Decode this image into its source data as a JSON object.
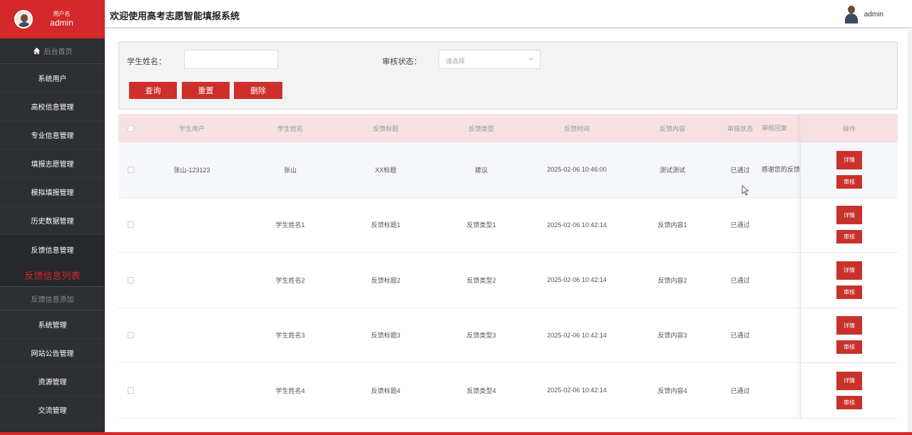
{
  "app": {
    "title": "欢迎使用高考志愿智能填报系统",
    "user_label": "用户名",
    "username": "admin",
    "header_user": "admin"
  },
  "sidebar": {
    "home": "后台首页",
    "items": [
      {
        "label": "系统用户"
      },
      {
        "label": "高校信息管理"
      },
      {
        "label": "专业信息管理"
      },
      {
        "label": "填报志愿管理"
      },
      {
        "label": "模拟填报管理"
      },
      {
        "label": "历史数据管理"
      },
      {
        "label": "反馈信息管理"
      }
    ],
    "sub_current": "反馈信息列表",
    "sub_other": "反馈信息添加",
    "items_after": [
      {
        "label": "系统管理"
      },
      {
        "label": "网站公告管理"
      },
      {
        "label": "资源管理"
      },
      {
        "label": "交流管理"
      }
    ]
  },
  "search": {
    "name_label": "学生姓名：",
    "name_value": "",
    "status_label": "审核状态：",
    "status_placeholder": "请选择",
    "query_btn": "查询",
    "reset_btn": "重置",
    "delete_btn": "删除"
  },
  "table": {
    "headers": [
      "学生用户",
      "学生姓名",
      "反馈标题",
      "反馈类型",
      "反馈时间",
      "反馈内容",
      "审核状态",
      "审核回复",
      "操作"
    ],
    "detail_btn": "详情",
    "review_btn": "审核",
    "rows": [
      {
        "user": "张山-123123",
        "name": "张山",
        "title": "XX标题",
        "type": "建议",
        "time": "2025-02-06 10:46:00",
        "content": "测试测试",
        "status": "已通过",
        "reply": "感谢您的反馈"
      },
      {
        "user": "",
        "name": "学生姓名1",
        "title": "反馈标题1",
        "type": "反馈类型1",
        "time": "2025-02-06 10:42:14",
        "content": "反馈内容1",
        "status": "已通过",
        "reply": ""
      },
      {
        "user": "",
        "name": "学生姓名2",
        "title": "反馈标题2",
        "type": "反馈类型2",
        "time": "2025-02-06 10:42:14",
        "content": "反馈内容2",
        "status": "已通过",
        "reply": ""
      },
      {
        "user": "",
        "name": "学生姓名3",
        "title": "反馈标题3",
        "type": "反馈类型3",
        "time": "2025-02-06 10:42:14",
        "content": "反馈内容3",
        "status": "已通过",
        "reply": ""
      },
      {
        "user": "",
        "name": "学生姓名4",
        "title": "反馈标题4",
        "type": "反馈类型4",
        "time": "2025-02-06 10:42:14",
        "content": "反馈内容4",
        "status": "已通过",
        "reply": ""
      }
    ]
  },
  "colors": {
    "brand": "#d4282b",
    "sidebar_bg": "#2d2f33",
    "button": "#cf2f2a",
    "table_header": "#f7e1e2"
  }
}
